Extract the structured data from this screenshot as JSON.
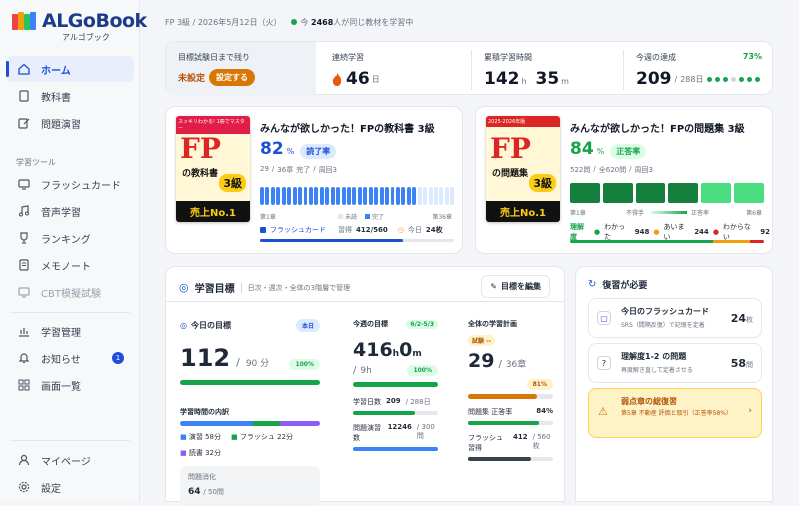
{
  "app": {
    "name": "ALGoBook",
    "sub": "アルゴブック"
  },
  "nav": {
    "items": [
      {
        "label": "ホーム"
      },
      {
        "label": "教科書"
      },
      {
        "label": "問題演習"
      }
    ],
    "tools_label": "学習ツール",
    "tools": [
      {
        "label": "フラッシュカード"
      },
      {
        "label": "音声学習"
      },
      {
        "label": "ランキング"
      },
      {
        "label": "メモノート"
      },
      {
        "label": "CBT模擬試験"
      }
    ],
    "manage": [
      {
        "label": "学習管理"
      },
      {
        "label": "お知らせ",
        "badge": "1"
      },
      {
        "label": "画面一覧"
      }
    ],
    "bottom": [
      {
        "label": "マイページ"
      },
      {
        "label": "設定"
      }
    ]
  },
  "header": {
    "breadcrumb": "FP 3級 / 2026年5月12日（火）",
    "now_prefix": "今",
    "now_count": "2468",
    "now_suffix": "人が同じ教材を学習中"
  },
  "stats": {
    "exam": {
      "label": "目標試験日まで残り",
      "value": "未設定",
      "button": "設定する"
    },
    "streak": {
      "label": "連続学習",
      "value": "46",
      "unit": "日"
    },
    "time": {
      "label": "累積学習時間",
      "hours": "142",
      "h": "h",
      "mins": "35",
      "m": "m"
    },
    "weekly": {
      "label": "今週の達成",
      "pct": "73%",
      "value": "209",
      "sep": "/",
      "total": "288日",
      "dots": [
        1,
        1,
        1,
        0,
        1,
        1,
        1
      ]
    }
  },
  "textbook": {
    "title": "みんなが欲しかった！FPの教科書 3級",
    "pct": "82",
    "pct_unit": "%",
    "pill": "読了率",
    "line_a": "29",
    "line_b": "/",
    "line_c": "36章",
    "line_d": "完了",
    "line_e": "/",
    "line_f": "周回3",
    "first": "第1章",
    "last": "第36章",
    "legend_unread": "未読",
    "legend_done": "完了",
    "flash_label": "フラッシュカード",
    "flash_learn": "習得",
    "flash_val": "412/560",
    "today_label": "今日",
    "today_val": "24枚",
    "chapters_done": 29,
    "chapters_total": 36,
    "cover": {
      "top": "スッキリわかる! 1冊でマスター",
      "title": "FP",
      "title2": "の教科書",
      "badge": "売上No.1",
      "level": "3級"
    }
  },
  "workbook": {
    "title": "みんなが欲しかった！FPの問題集 3級",
    "pct": "84",
    "pct_unit": "%",
    "pill": "正答率",
    "line_a": "522問",
    "line_b": "/",
    "line_c": "全620問",
    "line_d": "/",
    "line_e": "周回3",
    "first": "第1章",
    "mid_weak": "不得手",
    "mid_strong": "正答率",
    "last": "第6章",
    "levels": [
      0.9,
      0.85,
      0.8,
      0.88,
      0.7,
      0.6
    ],
    "understanding": "理解度",
    "u1": "わかった",
    "u1v": "948",
    "u2": "あいまい",
    "u2v": "244",
    "u3": "わからない",
    "u3v": "92",
    "cover": {
      "top": "2025-2026年版",
      "title": "FP",
      "title2": "の問題集",
      "badge": "売上No.1",
      "level": "3級"
    }
  },
  "goals": {
    "title": "学習目標",
    "desc": "日次・週次・全体の3階層で管理",
    "edit": "目標を編集",
    "today": {
      "label": "今日の目標",
      "tag": "本日",
      "value": "112",
      "sep": "/",
      "goal": "90 分",
      "pct": "100%",
      "breakdown_title": "学習時間の内訳",
      "b1": "演習 58分",
      "b2": "フラッシュ 22分",
      "b3": "読書 32分",
      "digest_label": "問題消化",
      "digest_val": "64",
      "digest_total": "/ 50問"
    },
    "week": {
      "label": "今週の目標",
      "tag": "6/2-5/3",
      "value_h": "416",
      "h": "h",
      "value_m": "0",
      "m": "m",
      "sep": "/",
      "goal": "9h",
      "pct": "100%",
      "r1": "学習日数",
      "r1v": "209",
      "r1t": "/ 288日",
      "r2": "問題演習数",
      "r2v": "12246",
      "r2t": "/ 300問"
    },
    "total": {
      "label": "全体の学習計画",
      "tag": "試験 --",
      "value": "29",
      "sep": "/",
      "goal": "36章",
      "pct": "81%",
      "r1": "問題集 正答率",
      "r1v": "84%",
      "r2": "フラッシュ習得",
      "r2v": "412",
      "r2t": "/ 560枚"
    }
  },
  "review": {
    "title": "復習が必要",
    "items": [
      {
        "title": "今日のフラッシュカード",
        "sub": "SRS（間隔反復）で記憶を定着",
        "count": "24",
        "unit": "枚"
      },
      {
        "title": "理解度1-2 の問題",
        "sub": "再度解き直して定着させる",
        "count": "58",
        "unit": "問"
      },
      {
        "title": "弱点章の総復習",
        "sub": "第5章 不動産 評価と取引（正答率58%）"
      }
    ]
  },
  "colors": {
    "accent": "#1d4ed8",
    "green": "#16a34a",
    "orange": "#f59e0b"
  }
}
